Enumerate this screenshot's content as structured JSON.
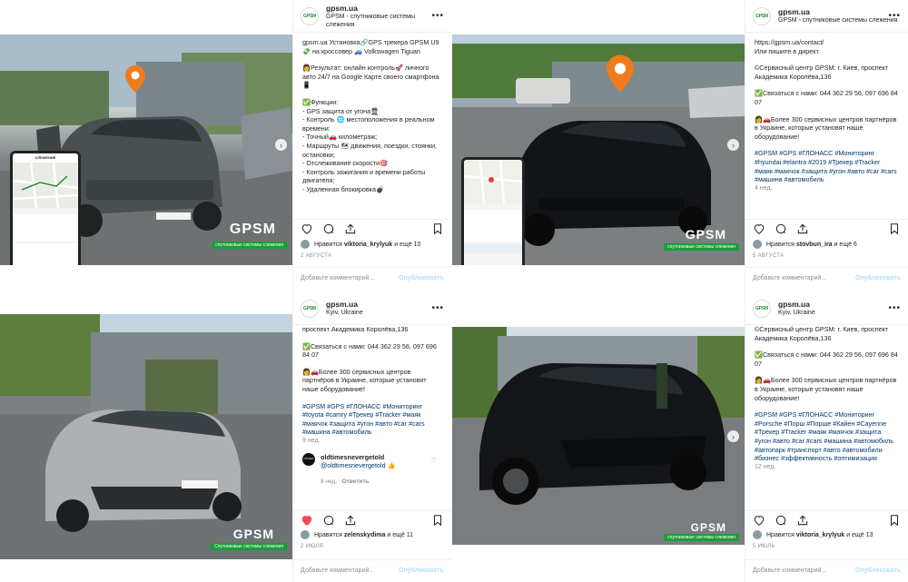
{
  "brand": {
    "logo": "GPSM",
    "accent": "#1a9e3a",
    "pin_color": "#f07a1c",
    "link_color": "#00376b"
  },
  "posts": [
    {
      "header": {
        "name": "gpsm.ua",
        "subtitle": "GPSM - спутниковые системы слежения"
      },
      "caption": [
        "gpsm.ua Установка🔗GPS трекера GPSM U9💸 на кроссовер 🚙 Volkswagen Tiguan",
        "",
        "👩Результат: онлайн контроль🚀 личного авто 24/7 на Google Карте своего смартфона📱",
        "",
        "✅Функции:",
        "  - GPS защита от угона👮",
        "  - Контроль 🌐 местоположения в реальном времени:",
        "  - Точный🚗 километраж;",
        "  - Маршруты 🗺 движения, поездки, стоянки, остановки;",
        "  - Отслеживание скорости🎯",
        "  - Контроль зажигания и времени работы двигателя;",
        "  - Удаленная блокировка💣"
      ],
      "likes": {
        "user": "viktoria_krylyuk",
        "rest": "и ещё 10",
        "prefix": "Нравится"
      },
      "date": "2 АВГУСТА",
      "comment_placeholder": "Добавьте комментарий...",
      "publish": "Опубликовать",
      "overlay": {
        "brand": "GPSM",
        "tagline": "спутниковые системы слежения"
      },
      "phone_title": "СЛЕЖЕНИЕ"
    },
    {
      "header": {
        "name": "gpsm.ua",
        "subtitle": "GPSM - спутниковые системы слежения"
      },
      "caption": [
        "https://gpsm.ua/contact/",
        "Или пишите в директ.",
        "",
        "©Сервисный центр GPSM: г. Киев, проспект Академика Королёва,136",
        "",
        "✅Связаться с нами: 044 362 29 56, 097 696 84 07",
        "",
        "👩🚗Более 300 сервисных центров партнёров в Украине, которые установят наше оборудование!",
        ""
      ],
      "tags": "#GPSM #GPS #ГЛОНАСС #Мониторинг #hyundai #elantra #2019 #Трекер #Tracker #маяк #маячок #защита #угон #авто #car #cars #машина #автомобиль",
      "age": "4 нед.",
      "likes": {
        "user": "stovbun_ira",
        "rest": "и ещё 6",
        "prefix": "Нравится"
      },
      "date": "5 АВГУСТА",
      "comment_placeholder": "Добавьте комментарий...",
      "publish": "Опубликовать",
      "overlay": {
        "brand": "GPSM",
        "tagline": "спутниковые системы слежения"
      }
    },
    {
      "header": {
        "name": "gpsm.ua",
        "subtitle": "Kyiv, Ukraine"
      },
      "caption": [
        "проспект Академика Королёва,136",
        "",
        "✅Связаться с нами: 044 362 29 56, 097 696 84 07",
        "",
        "👩🚗Более 300 сервисных центров партнёров в Украине, которые установят наше оборудование!",
        ""
      ],
      "tags": "#GPSM #GPS #ГЛОНАСС #Мониторинг #toyota #camry #Трекер #Tracker #маяк #маячок #защита #угон #авто #car #cars #машина #автомобиль",
      "age": "9 нед.",
      "reply": {
        "user": "oldtimesnevergetold",
        "text": "@oldtimesnevergetold 👍",
        "age": "8 нед.",
        "reply_label": "Ответить",
        "avatar_text": "OTNGO"
      },
      "likes": {
        "user": "zelenskydima",
        "rest": "и ещё 11",
        "prefix": "Нравится"
      },
      "date": "2 ИЮЛЯ",
      "comment_placeholder": "Добавьте комментарий...",
      "publish": "Опубликовать",
      "overlay": {
        "brand": "GPSM",
        "tagline": "Спутниковые системы слежения"
      }
    },
    {
      "header": {
        "name": "gpsm.ua",
        "subtitle": "Kyiv, Ukraine"
      },
      "caption": [
        "©Сервисный центр GPSM: г. Киев, проспект Академика Королёва,136",
        "",
        "✅Связаться с нами: 044 362 29 56, 097 696 84 07",
        "",
        "👩🚗Более 300 сервисных центров партнёров в Украине, которые установят наше оборудование!",
        ""
      ],
      "tags": "#GPSM #GPS #ГЛОНАСС #Мониторинг #Porsche #Порш #Порше #Кайен #Cayenne #Трекер #Tracker #маяк #маячок #защита #угон #авто #car #cars #машина #автомобиль #автопарк #транспорт #авто #автомобили #бизнес #эффективность #оптимизация",
      "age": "12 нед.",
      "likes": {
        "user": "viktoria_krylyuk",
        "rest": "и ещё 13",
        "prefix": "Нравится"
      },
      "date": "5 ИЮЛЬ",
      "comment_placeholder": "Добавьте комментарий...",
      "publish": "Опубликовать",
      "overlay": {
        "brand": "GPSM",
        "tagline": "спутниковые системы слежения"
      }
    }
  ],
  "icons": [
    "heart-icon",
    "comment-icon",
    "share-icon",
    "bookmark-icon",
    "more-icon",
    "location-pin-icon",
    "chevron-right-icon"
  ]
}
